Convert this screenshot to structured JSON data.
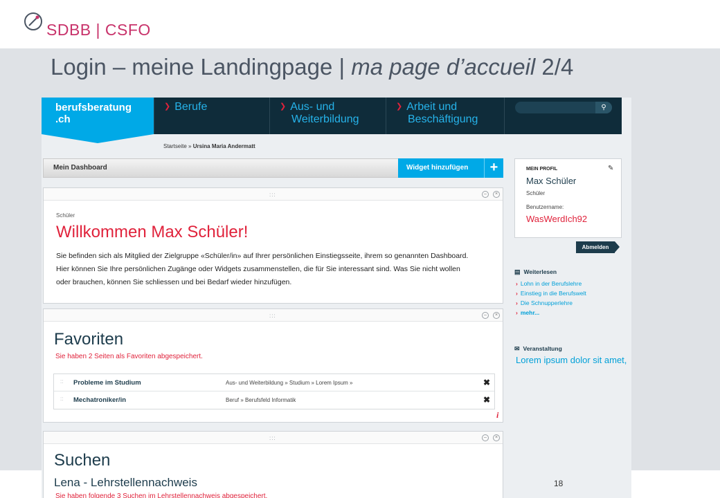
{
  "slide": {
    "logo_text": "SDBB | CSFO",
    "title_main": "Login – meine Landingpage | ",
    "title_italic": "ma page d’accueil",
    "title_suffix": " 2/4",
    "page_number": "18"
  },
  "site": {
    "brand_line1": "berufsberatung",
    "brand_line2": ".ch",
    "nav": [
      {
        "line1": "Berufe",
        "line2": ""
      },
      {
        "line1": "Aus- und",
        "line2": "Weiterbildung"
      },
      {
        "line1": "Arbeit und",
        "line2": "Beschäftigung"
      }
    ],
    "breadcrumb_home": "Startseite »",
    "breadcrumb_user": "Ursina Maria Andermatt"
  },
  "dashboard": {
    "title": "Mein Dashboard",
    "add_widget": "Widget hinzufügen",
    "add_icon": "+"
  },
  "welcome": {
    "kicker": "Schüler",
    "title": "Willkommen Max Schüler!",
    "text": "Sie befinden sich als Mitglied der Zielgruppe «Schüler/in» auf Ihrer persönlichen Einstiegsseite, ihrem so genannten Dashboard. Hier können Sie Ihre persönlichen Zugänge oder Widgets zusammenstellen, die für Sie interessant sind. Was Sie nicht wollen oder brauchen, können Sie schliessen und bei Bedarf wieder hinzufügen."
  },
  "favorites": {
    "title": "Favoriten",
    "subtitle": "Sie haben 2 Seiten als Favoriten abgespeichert.",
    "rows": [
      {
        "name": "Probleme im Studium",
        "path": "Aus- und Weiterbildung » Studium » Lorem Ipsum »"
      },
      {
        "name": "Mechatroniker/in",
        "path": "Beruf » Berufsfeld Informatik"
      }
    ]
  },
  "search": {
    "title": "Suchen",
    "subtitle": "Lena - Lehrstellennachweis",
    "note": "Sie haben folgende 3 Suchen im Lehrstellennachweis abgespeichert."
  },
  "profile": {
    "heading": "MEIN PROFIL",
    "name": "Max Schüler",
    "role": "Schüler",
    "username_label": "Benutzername:",
    "username": "WasWerdIch92",
    "logout": "Abmelden"
  },
  "further_reading": {
    "heading": "Weiterlesen",
    "links": [
      "Lohn in der Berufslehre",
      "Einstieg in die Berufswelt",
      "Die Schnupperlehre",
      "mehr..."
    ]
  },
  "event": {
    "heading": "Veranstaltung",
    "text": "Lorem ipsum dolor sit amet,"
  },
  "colors": {
    "brand_blue": "#00a9e7",
    "nav_dark": "#0f2c3a",
    "accent_red": "#e0223b",
    "logo_magenta": "#c8336b"
  }
}
